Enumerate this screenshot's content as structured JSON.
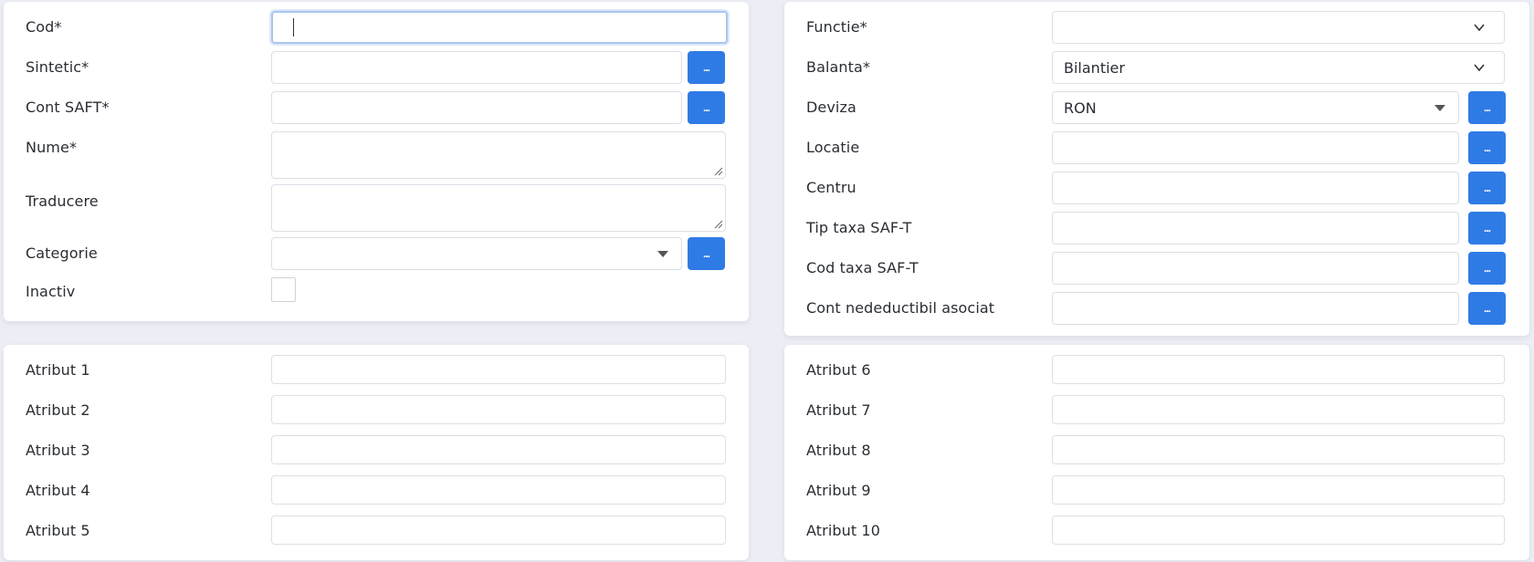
{
  "left_form": {
    "cod": {
      "label": "Cod*",
      "value": ""
    },
    "sintetic": {
      "label": "Sintetic*",
      "value": "",
      "button": "..."
    },
    "cont_saft": {
      "label": "Cont SAFT*",
      "value": "",
      "button": "..."
    },
    "nume": {
      "label": "Nume*",
      "value": ""
    },
    "traducere": {
      "label": "Traducere",
      "value": ""
    },
    "categorie": {
      "label": "Categorie",
      "value": "",
      "button": "..."
    },
    "inactiv": {
      "label": "Inactiv",
      "checked": false
    }
  },
  "right_form": {
    "functie": {
      "label": "Functie*",
      "value": ""
    },
    "balanta": {
      "label": "Balanta*",
      "value": "Bilantier"
    },
    "deviza": {
      "label": "Deviza",
      "value": "RON",
      "button": "..."
    },
    "locatie": {
      "label": "Locatie",
      "value": "",
      "button": "..."
    },
    "centru": {
      "label": "Centru",
      "value": "",
      "button": "..."
    },
    "tip_taxa": {
      "label": "Tip taxa SAF-T",
      "value": "",
      "button": "..."
    },
    "cod_taxa": {
      "label": "Cod taxa SAF-T",
      "value": "",
      "button": "..."
    },
    "cont_nedeductibil": {
      "label": "Cont nedeductibil asociat",
      "value": "",
      "button": "..."
    }
  },
  "attributes_left": [
    "Atribut 1",
    "Atribut 2",
    "Atribut 3",
    "Atribut 4",
    "Atribut 5"
  ],
  "attributes_right": [
    "Atribut 6",
    "Atribut 7",
    "Atribut 8",
    "Atribut 9",
    "Atribut 10"
  ],
  "colors": {
    "accent": "#2f7be6",
    "background": "#eceef5",
    "card": "#ffffff",
    "border": "#dcdfe6",
    "focus_border": "#a9c6ee"
  },
  "icons": {
    "dropdown": "triangle-down-icon",
    "select": "chevron-down-icon",
    "resize": "resize-handle-icon"
  }
}
